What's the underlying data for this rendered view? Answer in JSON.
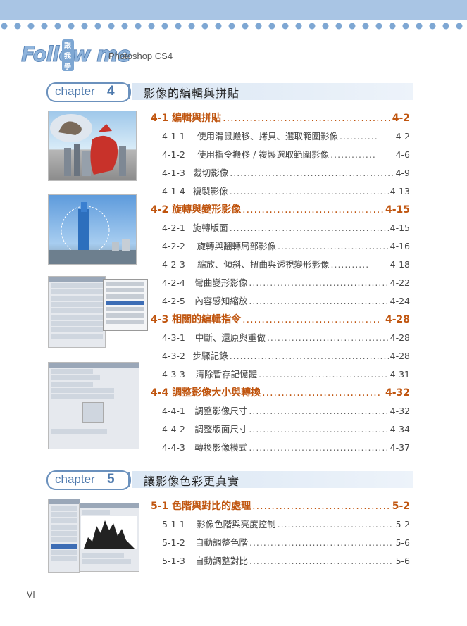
{
  "header": {
    "logo_text": "Follow me",
    "logo_badge": "跟我學",
    "product": "Photoshop CS4"
  },
  "chapters": [
    {
      "label": "chapter",
      "number": "4",
      "title": "影像的編輯與拼貼"
    },
    {
      "label": "chapter",
      "number": "5",
      "title": "讓影像色彩更真實"
    }
  ],
  "toc": {
    "s4_1": {
      "title": "4-1 編輯與拼貼",
      "page": "4-2",
      "dots": "................................................"
    },
    "s4_1_1": {
      "num": "4-1-1",
      "title": "使用滑鼠搬移、拷貝、選取範圍影像",
      "page": "4-2",
      "dots": "..........."
    },
    "s4_1_2": {
      "num": "4-1-2",
      "title": "使用指令搬移 / 複製選取範圍影像",
      "page": "4-6",
      "dots": "............."
    },
    "s4_1_3": {
      "num": "4-1-3",
      "title": "裁切影像",
      "page": "4-9",
      "dots": "....................................................."
    },
    "s4_1_4": {
      "num": "4-1-4",
      "title": "複製影像",
      "page": "4-13",
      "dots": "...................................................."
    },
    "s4_2": {
      "title": "4-2 旋轉與變形影像",
      "page": "4-15",
      "dots": "......................................"
    },
    "s4_2_1": {
      "num": "4-2-1",
      "title": "旋轉版面",
      "page": "4-15",
      "dots": "...................................................."
    },
    "s4_2_2": {
      "num": "4-2-2",
      "title": "旋轉與翻轉局部影像",
      "page": "4-16",
      "dots": "................................"
    },
    "s4_2_3": {
      "num": "4-2-3",
      "title": "縮放、傾斜、扭曲與透視變形影像",
      "page": "4-18",
      "dots": "..........."
    },
    "s4_2_4": {
      "num": "4-2-4",
      "title": "彎曲變形影像",
      "page": "4-22",
      "dots": "..........................................."
    },
    "s4_2_5": {
      "num": "4-2-5",
      "title": "內容感知縮放",
      "page": "4-24",
      "dots": "..........................................."
    },
    "s4_3": {
      "title": "4-3 相關的編輯指令",
      "page": "4-28",
      "dots": "...................................."
    },
    "s4_3_1": {
      "num": "4-3-1",
      "title": "中斷、還原與重做",
      "page": "4-28",
      "dots": "....................................."
    },
    "s4_3_2": {
      "num": "4-3-2",
      "title": "步驟記錄",
      "page": "4-28",
      "dots": "...................................................."
    },
    "s4_3_3": {
      "num": "4-3-3",
      "title": "清除暫存記憶體",
      "page": "4-31",
      "dots": "......................................."
    },
    "s4_4": {
      "title": "4-4 調整影像大小與轉換",
      "page": "4-32",
      "dots": "..............................."
    },
    "s4_4_1": {
      "num": "4-4-1",
      "title": "調整影像尺寸",
      "page": "4-32",
      "dots": "..........................................."
    },
    "s4_4_2": {
      "num": "4-4-2",
      "title": "調整版面尺寸",
      "page": "4-34",
      "dots": "..........................................."
    },
    "s4_4_3": {
      "num": "4-4-3",
      "title": "轉換影像模式",
      "page": "4-37",
      "dots": "..........................................."
    },
    "s5_1": {
      "title": "5-1 色階與對比的處理",
      "page": "5-2",
      "dots": "...................................."
    },
    "s5_1_1": {
      "num": "5-1-1",
      "title": "影像色階與亮度控制",
      "page": "5-2",
      "dots": ".................................."
    },
    "s5_1_2": {
      "num": "5-1-2",
      "title": "自動調整色階",
      "page": "5-6",
      "dots": "............................................"
    },
    "s5_1_3": {
      "num": "5-1-3",
      "title": "自動調整對比",
      "page": "5-6",
      "dots": "............................................"
    }
  },
  "footer": {
    "page_number": "VI"
  },
  "colors": {
    "accent": "#c0550f",
    "chapter_blue": "#4c78ac",
    "band": "#a9c5e4"
  }
}
